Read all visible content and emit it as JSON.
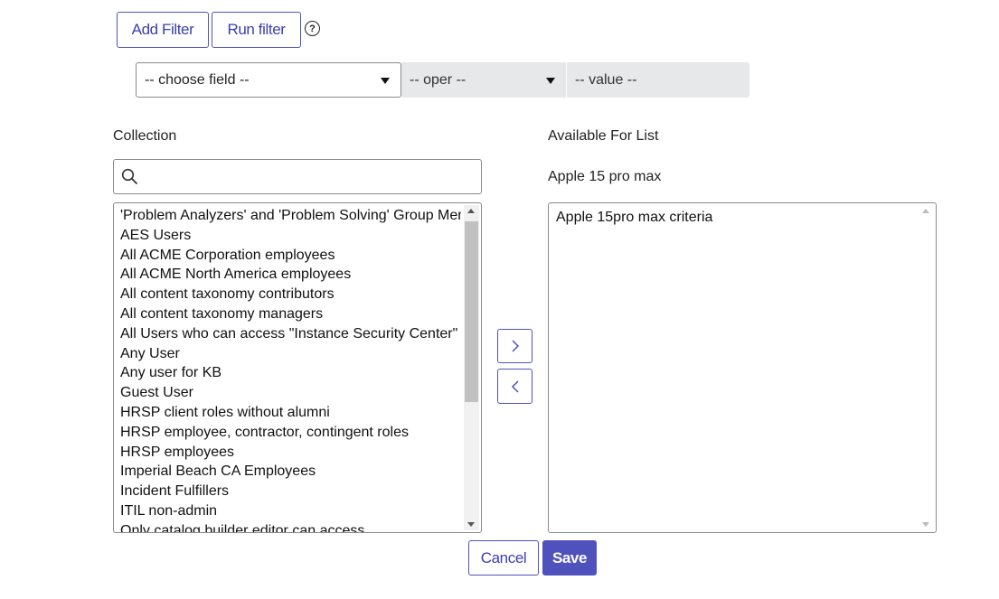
{
  "toolbar": {
    "add_filter_label": "Add Filter",
    "run_filter_label": "Run filter",
    "help_icon": "?"
  },
  "filter": {
    "field_value": "-- choose field --",
    "oper_value": "-- oper --",
    "value_value": "-- value --"
  },
  "collection": {
    "label": "Collection",
    "search_placeholder": "",
    "items": [
      "'Problem Analyzers' and 'Problem Solving' Group Members",
      "AES Users",
      "All ACME Corporation employees",
      "All ACME North America employees",
      "All content taxonomy contributors",
      "All content taxonomy managers",
      "All Users who can access \"Instance Security Center\"",
      "Any User",
      "Any user for KB",
      "Guest User",
      "HRSP client roles without alumni",
      "HRSP employee, contractor, contingent roles",
      "HRSP employees",
      "Imperial Beach CA Employees",
      "Incident Fulfillers",
      "ITIL non-admin",
      "Only catalog builder editor can access"
    ]
  },
  "available": {
    "label": "Available For List",
    "subtitle": "Apple 15 pro max",
    "items": [
      "Apple 15pro max criteria"
    ]
  },
  "icons": {
    "search": "search-icon",
    "help": "help-circle-icon",
    "move_right": "chevron-right-icon",
    "move_left": "chevron-left-icon"
  },
  "actions": {
    "cancel_label": "Cancel",
    "save_label": "Save"
  },
  "colors": {
    "accent": "#4f52bd",
    "gray_field": "#e6e8ea"
  }
}
